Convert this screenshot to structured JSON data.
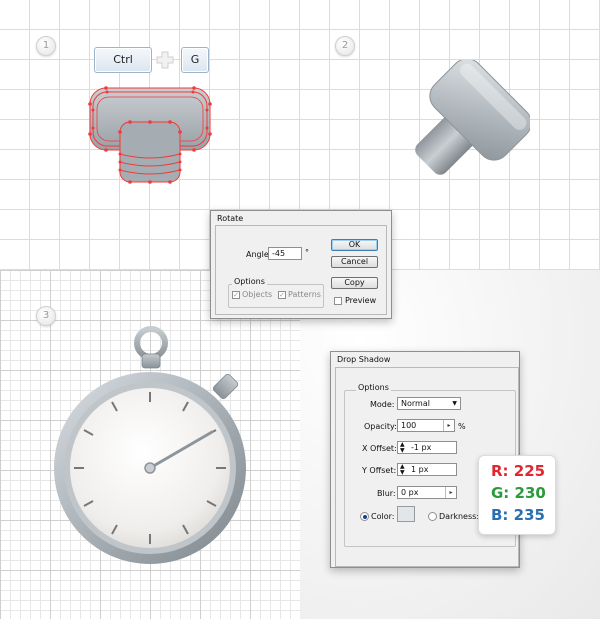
{
  "steps": [
    "1",
    "2",
    "3"
  ],
  "shortcut": {
    "key1": "Ctrl",
    "plus": "+",
    "key2": "G"
  },
  "rotate_dialog": {
    "title": "Rotate",
    "angle_label": "Angle:",
    "angle_value": "-45",
    "angle_unit": "°",
    "options_label": "Options",
    "objects_label": "Objects",
    "patterns_label": "Patterns",
    "ok_label": "OK",
    "cancel_label": "Cancel",
    "copy_label": "Copy",
    "preview_label": "Preview"
  },
  "drop_shadow_dialog": {
    "title": "Drop Shadow",
    "options_label": "Options",
    "mode_label": "Mode:",
    "mode_value": "Normal",
    "opacity_label": "Opacity:",
    "opacity_value": "100",
    "opacity_unit": "%",
    "x_offset_label": "X Offset:",
    "x_offset_value": "-1 px",
    "y_offset_label": "Y Offset:",
    "y_offset_value": "1 px",
    "blur_label": "Blur:",
    "blur_value": "0 px",
    "color_label": "Color:",
    "darkness_label": "Darkness:"
  },
  "rgb_card": {
    "r": "R: 225",
    "g": "G: 230",
    "b": "B: 235",
    "r_color": "#e0262f",
    "g_color": "#2a9a3a",
    "b_color": "#2a6fb0",
    "swatch_color": "#e1e6eb"
  },
  "icons": {
    "selected_shape": "grouped-path-shape",
    "rotated_shape": "rotated-3d-shape",
    "stopwatch": "stopwatch-icon",
    "plus": "plus-icon",
    "dropdown": "chevron-down-icon",
    "spinner": "spinner-arrows-icon"
  }
}
